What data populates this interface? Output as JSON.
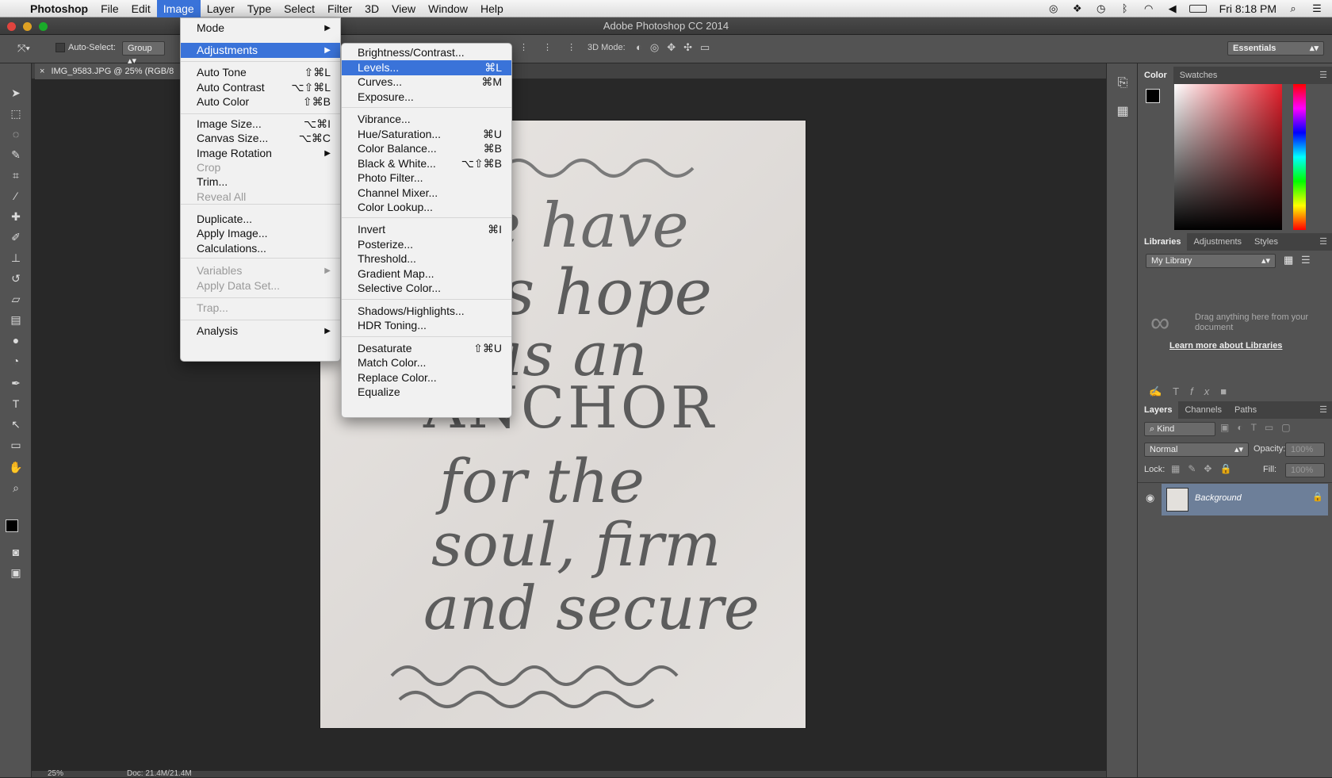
{
  "menubar": {
    "app": "Photoshop",
    "items": [
      "File",
      "Edit",
      "Image",
      "Layer",
      "Type",
      "Select",
      "Filter",
      "3D",
      "View",
      "Window",
      "Help"
    ],
    "clock": "Fri 8:18 PM"
  },
  "window_title": "Adobe Photoshop CC 2014",
  "options": {
    "auto_select": "Auto-Select:",
    "auto_select_value": "Group",
    "mode_3d": "3D Mode:",
    "workspace": "Essentials"
  },
  "document": {
    "tab_title": "IMG_9583.JPG @ 25% (RGB/8",
    "zoom": "25%",
    "doc_info": "Doc: 21.4M/21.4M"
  },
  "image_menu": {
    "items": [
      {
        "label": "Mode",
        "sc": "",
        "sub": true
      },
      {
        "label": "Adjustments",
        "sc": "",
        "sub": true,
        "hl": true
      },
      {
        "label": "Auto Tone",
        "sc": "⇧⌘L"
      },
      {
        "label": "Auto Contrast",
        "sc": "⌥⇧⌘L"
      },
      {
        "label": "Auto Color",
        "sc": "⇧⌘B"
      },
      {
        "label": "Image Size...",
        "sc": "⌥⌘I"
      },
      {
        "label": "Canvas Size...",
        "sc": "⌥⌘C"
      },
      {
        "label": "Image Rotation",
        "sc": "",
        "sub": true
      },
      {
        "label": "Crop",
        "sc": "",
        "dis": true
      },
      {
        "label": "Trim...",
        "sc": ""
      },
      {
        "label": "Reveal All",
        "sc": "",
        "dis": true
      },
      {
        "label": "Duplicate...",
        "sc": ""
      },
      {
        "label": "Apply Image...",
        "sc": ""
      },
      {
        "label": "Calculations...",
        "sc": ""
      },
      {
        "label": "Variables",
        "sc": "",
        "sub": true,
        "dis": true
      },
      {
        "label": "Apply Data Set...",
        "sc": "",
        "dis": true
      },
      {
        "label": "Trap...",
        "sc": "",
        "dis": true
      },
      {
        "label": "Analysis",
        "sc": "",
        "sub": true
      }
    ]
  },
  "adjust_menu": {
    "items": [
      {
        "label": "Brightness/Contrast...",
        "sc": ""
      },
      {
        "label": "Levels...",
        "sc": "⌘L",
        "hl": true
      },
      {
        "label": "Curves...",
        "sc": "⌘M"
      },
      {
        "label": "Exposure...",
        "sc": ""
      },
      {
        "label": "Vibrance...",
        "sc": ""
      },
      {
        "label": "Hue/Saturation...",
        "sc": "⌘U"
      },
      {
        "label": "Color Balance...",
        "sc": "⌘B"
      },
      {
        "label": "Black & White...",
        "sc": "⌥⇧⌘B"
      },
      {
        "label": "Photo Filter...",
        "sc": ""
      },
      {
        "label": "Channel Mixer...",
        "sc": ""
      },
      {
        "label": "Color Lookup...",
        "sc": ""
      },
      {
        "label": "Invert",
        "sc": "⌘I"
      },
      {
        "label": "Posterize...",
        "sc": ""
      },
      {
        "label": "Threshold...",
        "sc": ""
      },
      {
        "label": "Gradient Map...",
        "sc": ""
      },
      {
        "label": "Selective Color...",
        "sc": ""
      },
      {
        "label": "Shadows/Highlights...",
        "sc": ""
      },
      {
        "label": "HDR Toning...",
        "sc": ""
      },
      {
        "label": "Desaturate",
        "sc": "⇧⌘U"
      },
      {
        "label": "Match Color...",
        "sc": ""
      },
      {
        "label": "Replace Color...",
        "sc": ""
      },
      {
        "label": "Equalize",
        "sc": ""
      }
    ]
  },
  "panels": {
    "color_tabs": [
      "Color",
      "Swatches"
    ],
    "lib_tabs": [
      "Libraries",
      "Adjustments",
      "Styles"
    ],
    "library_select": "My Library",
    "drag_hint": "Drag anything here from your document",
    "learn_more": "Learn more about Libraries",
    "layers_tabs": [
      "Layers",
      "Channels",
      "Paths"
    ],
    "kind": "Kind",
    "blend": "Normal",
    "opacity_label": "Opacity:",
    "opacity": "100%",
    "lock_label": "Lock:",
    "fill_label": "Fill:",
    "fill": "100%",
    "layer_name": "Background"
  },
  "lettering": [
    "we have",
    "this hope",
    "as an",
    "ANCHOR",
    "for the",
    "soul, firm",
    "and secure"
  ]
}
